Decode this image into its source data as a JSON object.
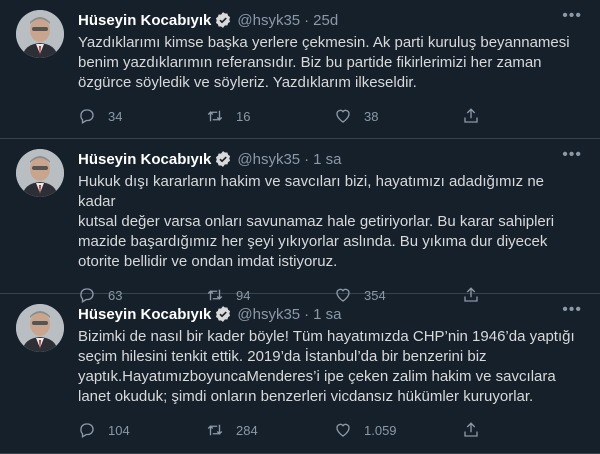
{
  "tweets": [
    {
      "name": "Hüseyin Kocabıyık",
      "handle": "@hsyk35",
      "separator": "·",
      "time": "25d",
      "text": "Yazdıklarımı kimse başka yerlere çekmesin. Ak parti kuruluş beyannamesi\nbenim yazdıklarımın referansıdır. Biz bu partide fikirlerimizi her zaman\nözgürce söyledik ve söyleriz. Yazdıklarım ilkeseldir.",
      "replies": "34",
      "retweets": "16",
      "likes": "38"
    },
    {
      "name": "Hüseyin Kocabıyık",
      "handle": "@hsyk35",
      "separator": "·",
      "time": "1 sa",
      "text": "Hukuk dışı kararların hakim ve savcıları bizi, hayatımızı adadığımız ne kadar\nkutsal değer varsa onları savunamaz hale getiriyorlar. Bu karar sahipleri\nmazide başardığımız her şeyi yıkıyorlar aslında. Bu yıkıma dur diyecek\notorite bellidir ve ondan imdat istiyoruz.",
      "replies": "63",
      "retweets": "94",
      "likes": "354"
    },
    {
      "name": "Hüseyin Kocabıyık",
      "handle": "@hsyk35",
      "separator": "·",
      "time": "1 sa",
      "text": "Bizimki de nasıl bir kader böyle! Tüm hayatımızda CHP’nin 1946’da yaptığı\nseçim hilesini tenkit ettik. 2019’da İstanbul’da bir benzerini biz\nyaptık.HayatımızboyuncaMenderes’i ipe çeken zalim hakim ve savcılara\nlanet okuduk; şimdi onların benzerleri vicdansız hükümler kuruyorlar.",
      "replies": "104",
      "retweets": "284",
      "likes": "1.059"
    }
  ],
  "icons": {
    "verified": "verified-badge-icon",
    "more": "more-dots-icon",
    "reply": "reply-icon",
    "retweet": "retweet-icon",
    "like": "heart-icon",
    "share": "share-icon"
  },
  "colors": {
    "background": "#15202b",
    "divider": "#38444d",
    "text": "#d9d9d9",
    "muted": "#8b98a5",
    "verified": "#1d9bf0"
  }
}
